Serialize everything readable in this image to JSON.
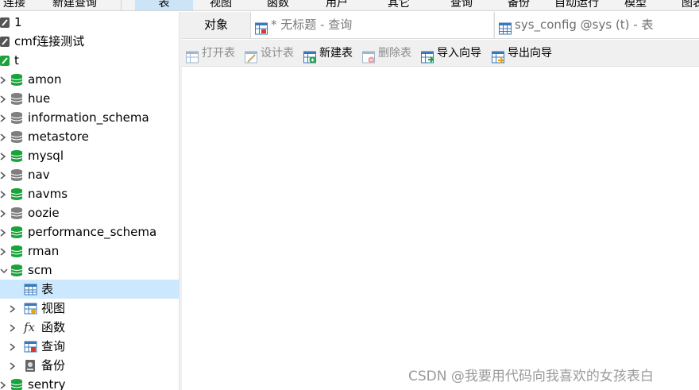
{
  "menubar": {
    "items": [
      "连接",
      "新建查询",
      "表",
      "视图",
      "函数",
      "用户",
      "其它",
      "查询",
      "备份",
      "自动运行",
      "模型",
      "图表"
    ],
    "active": "表"
  },
  "tree": {
    "connections": [
      {
        "label": "1"
      },
      {
        "label": "cmf连接测试"
      },
      {
        "label": "t"
      }
    ],
    "databases": [
      {
        "label": "amon",
        "color": "#1aa33a"
      },
      {
        "label": "hue",
        "color": "#7f7f7f"
      },
      {
        "label": "information_schema",
        "color": "#7f7f7f"
      },
      {
        "label": "metastore",
        "color": "#7f7f7f"
      },
      {
        "label": "mysql",
        "color": "#1aa33a"
      },
      {
        "label": "nav",
        "color": "#7f7f7f"
      },
      {
        "label": "navms",
        "color": "#1aa33a"
      },
      {
        "label": "oozie",
        "color": "#7f7f7f"
      },
      {
        "label": "performance_schema",
        "color": "#1aa33a"
      },
      {
        "label": "rman",
        "color": "#1aa33a"
      },
      {
        "label": "scm",
        "color": "#1aa33a"
      }
    ],
    "scm_children": [
      {
        "label": "表",
        "icon": "table-icon"
      },
      {
        "label": "视图",
        "icon": "view-icon"
      },
      {
        "label": "函数",
        "icon": "function-icon"
      },
      {
        "label": "查询",
        "icon": "query-icon"
      },
      {
        "label": "备份",
        "icon": "backup-icon"
      }
    ],
    "last_db": {
      "label": "sentry",
      "color": "#1aa33a"
    }
  },
  "tabs": {
    "objects": "对象",
    "query": "* 无标题 - 查询",
    "config": "sys_config @sys (t) - 表"
  },
  "toolbar": {
    "open_table": "打开表",
    "design_table": "设计表",
    "new_table": "新建表",
    "delete_table": "删除表",
    "import_wizard": "导入向导",
    "export_wizard": "导出向导"
  },
  "watermark": "CSDN @我要用代码向我喜欢的女孩表白"
}
